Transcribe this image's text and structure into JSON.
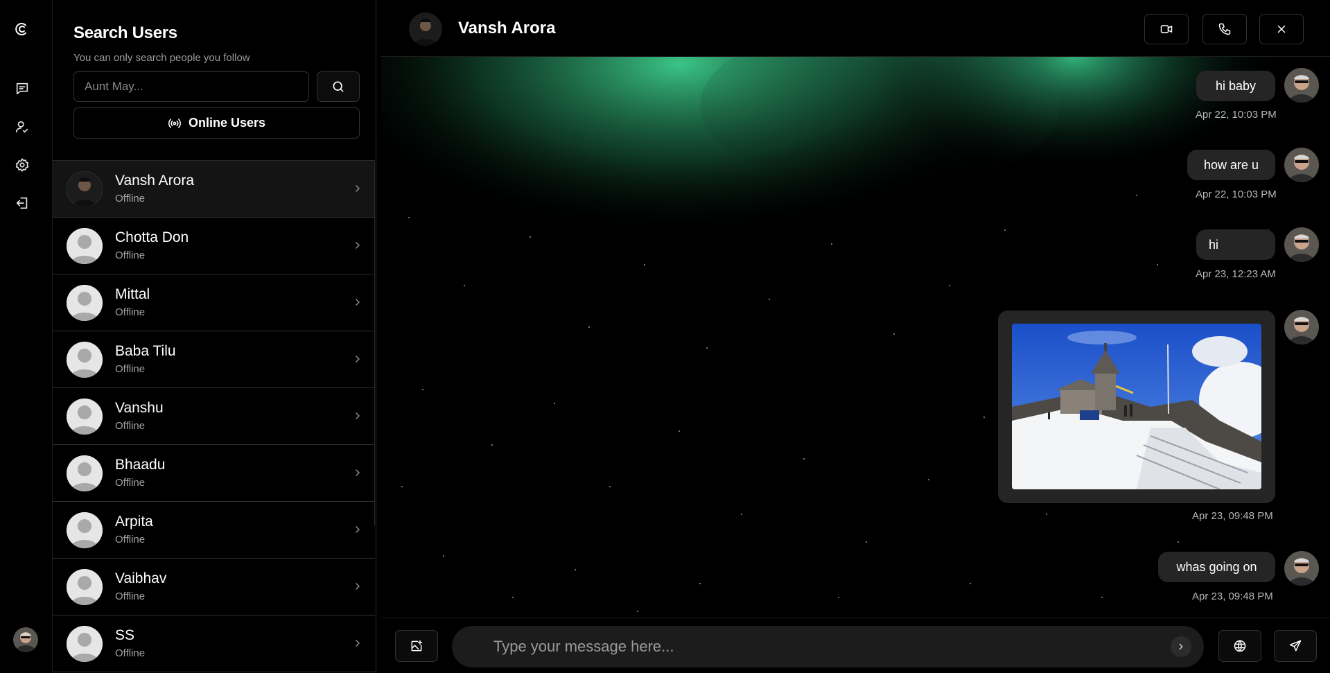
{
  "rail": {
    "items": [
      {
        "icon": "logo-icon"
      },
      {
        "icon": "chat-icon"
      },
      {
        "icon": "user-check-icon"
      },
      {
        "icon": "gear-icon"
      },
      {
        "icon": "logout-icon"
      }
    ],
    "profile_icon": "avatar"
  },
  "panel": {
    "title": "Search Users",
    "subtitle": "You can only search people you follow",
    "search_placeholder": "Aunt May...",
    "online_button": "Online Users"
  },
  "users": [
    {
      "name": "Vansh Arora",
      "status": "Offline",
      "active": true
    },
    {
      "name": "Chotta Don",
      "status": "Offline"
    },
    {
      "name": "Mittal",
      "status": "Offline"
    },
    {
      "name": "Baba Tilu",
      "status": "Offline"
    },
    {
      "name": "Vanshu",
      "status": "Offline"
    },
    {
      "name": "Bhaadu",
      "status": "Offline"
    },
    {
      "name": "Arpita",
      "status": "Offline"
    },
    {
      "name": "Vaibhav",
      "status": "Offline"
    },
    {
      "name": "SS",
      "status": "Offline"
    }
  ],
  "chat": {
    "contact_name": "Vansh Arora",
    "header_buttons": [
      "video-icon",
      "phone-icon",
      "close-icon"
    ],
    "messages": [
      {
        "text": "hi baby",
        "time": "Apr 22, 10:03 PM"
      },
      {
        "text": "how are u",
        "time": "Apr 22, 10:03 PM"
      },
      {
        "text": "hi",
        "time": "Apr 23, 12:23 AM"
      },
      {
        "type": "image",
        "time": "Apr 23, 09:48 PM"
      },
      {
        "text": "whas going on",
        "time": "Apr 23, 09:48 PM"
      }
    ]
  },
  "composer": {
    "placeholder": "Type your message here...",
    "buttons": [
      "image-add-icon",
      "globe-icon",
      "send-icon"
    ]
  },
  "colors": {
    "background": "#000000",
    "bubble": "#252525",
    "aurora": "#3ecf8e",
    "muted": "#9a9a9a"
  }
}
